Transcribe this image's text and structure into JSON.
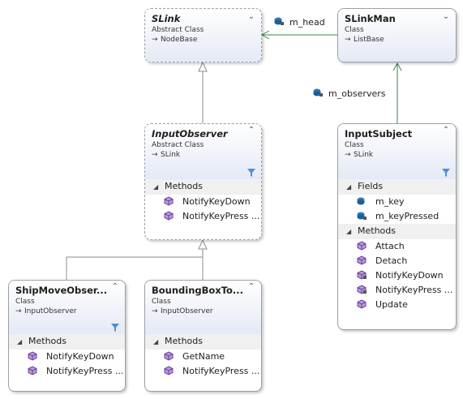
{
  "classes": {
    "slink": {
      "name": "SLink",
      "stereotype": "Abstract Class",
      "base": "NodeBase",
      "toggle": "⌄"
    },
    "slinkman": {
      "name": "SLinkMan",
      "stereotype": "Class",
      "base": "ListBase",
      "toggle": "⌄"
    },
    "inputobserver": {
      "name": "InputObserver",
      "stereotype": "Abstract Class",
      "base": "SLink",
      "toggle": "⌃",
      "sections": [
        {
          "label": "Methods",
          "members": [
            "NotifyKeyDown",
            "NotifyKeyPress ..."
          ]
        }
      ]
    },
    "inputsubject": {
      "name": "InputSubject",
      "stereotype": "Class",
      "base": "SLink",
      "toggle": "⌃",
      "sections": [
        {
          "label": "Fields",
          "members": [
            "m_key",
            "m_keyPressed"
          ]
        },
        {
          "label": "Methods",
          "members": [
            "Attach",
            "Detach",
            "NotifyKeyDown",
            "NotifyKeyPress ...",
            "Update"
          ]
        }
      ]
    },
    "shipmove": {
      "name": "ShipMoveObser...",
      "stereotype": "Class",
      "base": "InputObserver",
      "toggle": "⌃",
      "sections": [
        {
          "label": "Methods",
          "members": [
            "NotifyKeyDown",
            "NotifyKeyPress ..."
          ]
        }
      ]
    },
    "boundingbox": {
      "name": "BoundingBoxTo...",
      "stereotype": "Class",
      "base": "InputObserver",
      "toggle": "⌃",
      "sections": [
        {
          "label": "Methods",
          "members": [
            "GetName",
            "NotifyKeyPress ..."
          ]
        }
      ]
    }
  },
  "associations": {
    "m_head": "m_head",
    "m_observers": "m_observers"
  },
  "symbols": {
    "base_arrow": "→",
    "section_expanded": "◢"
  },
  "colors": {
    "inheritance_line": "#8c8c8c",
    "association_line": "#3f7f4f",
    "method_icon": "#6b3fa0",
    "field_icon": "#2a77b8",
    "header_gradient_end": "#e4e9f5"
  }
}
